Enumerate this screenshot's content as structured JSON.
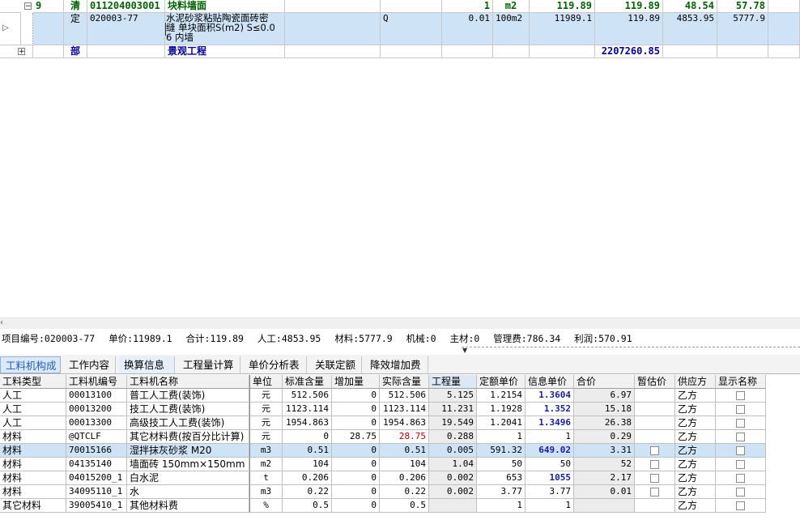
{
  "top_grid": {
    "row_qing": {
      "seq": "9",
      "type": "清",
      "code": "011204003001",
      "name": "块料墙面",
      "qty": "1",
      "unit": "m2",
      "price": "119.89",
      "total": "119.89",
      "labor": "48.54",
      "material": "57.78"
    },
    "row_ding": {
      "type": "定",
      "code": "020003-77",
      "icon": "Zc",
      "name_lines": [
        "水泥砂浆粘贴陶瓷面砖密",
        "缝 单块面积S(m2) S≤0.0",
        "6 内墙"
      ],
      "expr": "Q",
      "coef": "0.01",
      "unit": "100m2",
      "qty": "11989.1",
      "price": "119.89",
      "labor": "4853.95",
      "material": "5777.9"
    },
    "row_bu": {
      "type": "部",
      "name": "景观工程",
      "total": "2207260.85"
    }
  },
  "summary": {
    "code": "项目编号:020003-77",
    "unit_price": "单价:11989.1",
    "total": "合计:119.89",
    "labor": "人工:4853.95",
    "material": "材料:5777.9",
    "machine": "机械:0",
    "main_material": "主材:0",
    "mgmt_fee": "管理费:786.34",
    "profit": "利润:570.91"
  },
  "tabs": [
    "工料机构成",
    "工作内容",
    "换算信息",
    "工程量计算",
    "单价分析表",
    "关联定额",
    "降效增加费"
  ],
  "table": {
    "headers": [
      "工料类型",
      "工料机编号",
      "工料机名称",
      "单位",
      "标准含量",
      "增加量",
      "实际含量",
      "工程量",
      "定额单价",
      "信息单价",
      "合价",
      "暂估价",
      "供应方",
      "显示名称"
    ],
    "rows": [
      {
        "type": "人工",
        "code": "00013100",
        "name": "普工人工费(装饰)",
        "unit": "元",
        "std": "512.506",
        "add": "0",
        "actual": "512.506",
        "qty": "5.125",
        "dprice": "1.2154",
        "iprice": "1.3604",
        "sum": "6.97",
        "est": false,
        "supplier": "乙方",
        "show": false
      },
      {
        "type": "人工",
        "code": "00013200",
        "name": "技工人工费(装饰)",
        "unit": "元",
        "std": "1123.114",
        "add": "0",
        "actual": "1123.114",
        "qty": "11.231",
        "dprice": "1.1928",
        "iprice": "1.352",
        "sum": "15.18",
        "est": false,
        "supplier": "乙方",
        "show": false
      },
      {
        "type": "人工",
        "code": "00013300",
        "name": "高级技工人工费(装饰)",
        "unit": "元",
        "std": "1954.863",
        "add": "0",
        "actual": "1954.863",
        "qty": "19.549",
        "dprice": "1.2041",
        "iprice": "1.3496",
        "sum": "26.38",
        "est": false,
        "supplier": "乙方",
        "show": false
      },
      {
        "type": "材料",
        "code": "@QTCLF",
        "name": "其它材料费(按百分比计算)",
        "unit": "元",
        "std": "0",
        "add": "28.75",
        "actual": "28.75",
        "qty": "0.288",
        "dprice": "1",
        "iprice": "1",
        "sum": "0.29",
        "est": false,
        "supplier": "乙方",
        "show": false
      },
      {
        "type": "材料",
        "code": "70015166",
        "name": "湿拌抹灰砂浆 M20",
        "unit": "m3",
        "std": "0.51",
        "add": "0",
        "actual": "0.51",
        "qty": "0.005",
        "dprice": "591.32",
        "iprice": "649.02",
        "sum": "3.31",
        "est": true,
        "supplier": "乙方",
        "show": false
      },
      {
        "type": "材料",
        "code": "04135140",
        "name": "墙面砖 150mm×150mm",
        "unit": "m2",
        "std": "104",
        "add": "0",
        "actual": "104",
        "qty": "1.04",
        "dprice": "50",
        "iprice": "50",
        "sum": "52",
        "est": true,
        "supplier": "乙方",
        "show": false
      },
      {
        "type": "材料",
        "code": "04015200_1",
        "name": "白水泥",
        "unit": "t",
        "std": "0.206",
        "add": "0",
        "actual": "0.206",
        "qty": "0.002",
        "dprice": "653",
        "iprice": "1055",
        "sum": "2.17",
        "est": true,
        "supplier": "乙方",
        "show": false
      },
      {
        "type": "材料",
        "code": "34095110_1",
        "name": "水",
        "unit": "m3",
        "std": "0.22",
        "add": "0",
        "actual": "0.22",
        "qty": "0.002",
        "dprice": "3.77",
        "iprice": "3.77",
        "sum": "0.01",
        "est": true,
        "supplier": "乙方",
        "show": false
      },
      {
        "type": "其它材料",
        "code": "39005410_1",
        "name": "其他材料费",
        "unit": "%",
        "std": "0.5",
        "add": "0",
        "actual": "0.5",
        "qty": "",
        "dprice": "1",
        "iprice": "1",
        "sum": "",
        "est": false,
        "supplier": "乙方",
        "show": false
      }
    ]
  },
  "colors": {
    "selected_row": "#cfe3f7",
    "qing_text": "#006400",
    "bu_text": "#0000a0",
    "info_price_text": "#1a1aa8",
    "changed_value": "#c00000"
  }
}
